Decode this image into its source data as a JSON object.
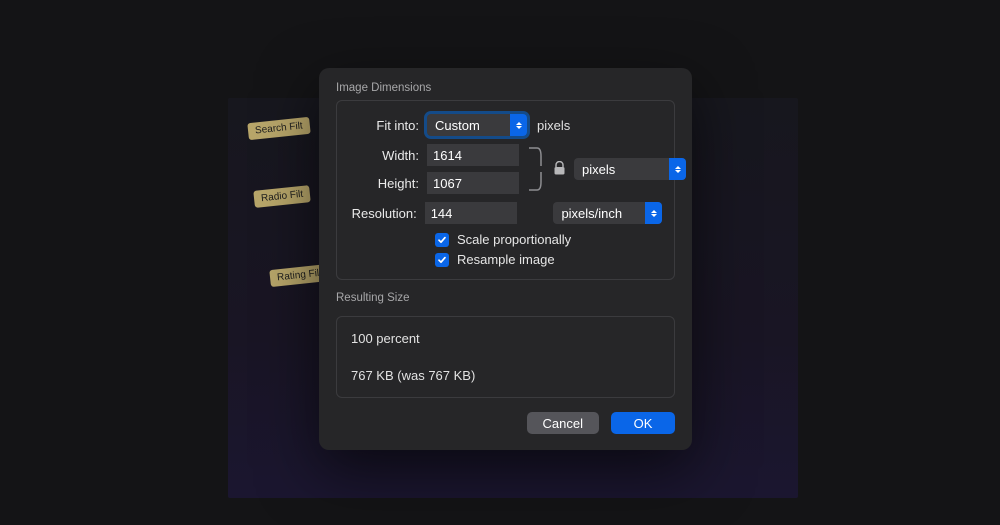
{
  "background": {
    "labels": [
      "Search Filt",
      "Radio Filt",
      "Rating Filt"
    ]
  },
  "dialog": {
    "section1_title": "Image Dimensions",
    "fit_into_label": "Fit into:",
    "fit_into_value": "Custom",
    "fit_into_unit": "pixels",
    "width_label": "Width:",
    "width_value": "1614",
    "height_label": "Height:",
    "height_value": "1067",
    "size_unit_value": "pixels",
    "resolution_label": "Resolution:",
    "resolution_value": "144",
    "resolution_unit_value": "pixels/inch",
    "scale_label": "Scale proportionally",
    "resample_label": "Resample image",
    "section2_title": "Resulting Size",
    "result_percent": "100 percent",
    "result_size": "767 KB (was 767 KB)",
    "cancel_label": "Cancel",
    "ok_label": "OK"
  }
}
